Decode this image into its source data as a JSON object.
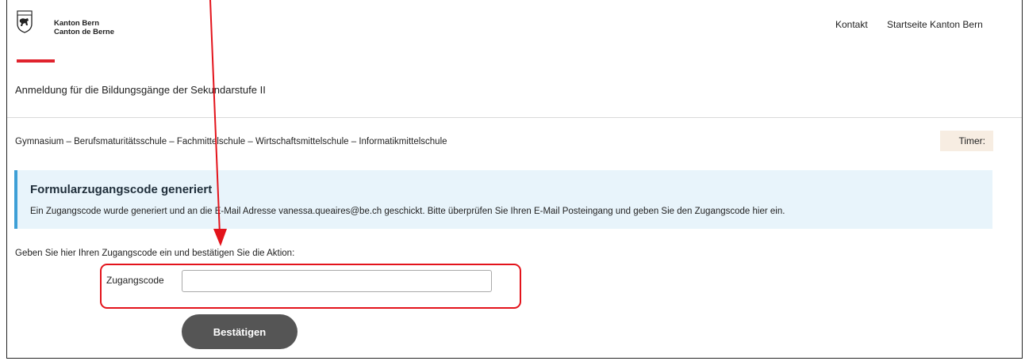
{
  "header": {
    "brand_line1": "Kanton Bern",
    "brand_line2": "Canton de Berne",
    "links": [
      "Kontakt",
      "Startseite Kanton Bern"
    ]
  },
  "page": {
    "title": "Anmeldung für die Bildungsgänge der Sekundarstufe II",
    "subtitle": "Gymnasium – Berufsmaturitätsschule – Fachmittelschule – Wirtschaftsmittelschule – Informatikmittelschule",
    "timer_label": "Timer:"
  },
  "info": {
    "title": "Formularzugangscode generiert",
    "text": "Ein Zugangscode wurde generiert und an die E-Mail Adresse vanessa.queaires@be.ch geschickt. Bitte überprüfen Sie Ihren E-Mail Posteingang und geben Sie den Zugangscode hier ein."
  },
  "form": {
    "instruction": "Geben Sie hier Ihren Zugangscode ein und bestätigen Sie die Aktion:",
    "code_label": "Zugangscode",
    "code_value": "",
    "confirm_label": "Bestätigen"
  },
  "colors": {
    "accent_red": "#e0232d",
    "info_border": "#3d9fd6",
    "info_bg": "#e8f4fb",
    "button_bg": "#555555",
    "annotation_red": "#e3131b"
  }
}
